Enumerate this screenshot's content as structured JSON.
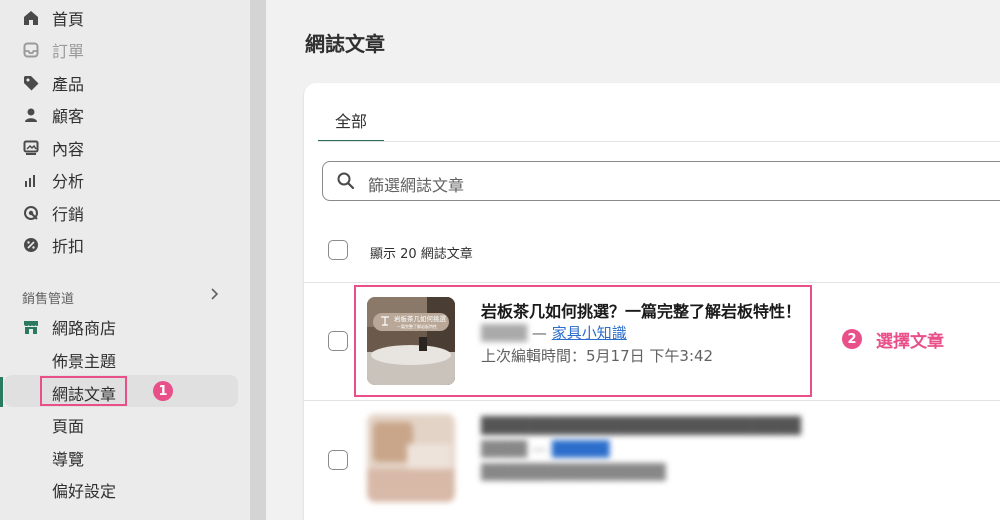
{
  "sidebar": {
    "items": [
      {
        "label": "首頁",
        "icon": "home-icon"
      },
      {
        "label": "訂單",
        "icon": "inbox-icon"
      },
      {
        "label": "產品",
        "icon": "tag-icon"
      },
      {
        "label": "顧客",
        "icon": "person-icon"
      },
      {
        "label": "內容",
        "icon": "image-icon"
      },
      {
        "label": "分析",
        "icon": "bar-chart-icon"
      },
      {
        "label": "行銷",
        "icon": "target-icon"
      },
      {
        "label": "折扣",
        "icon": "discount-icon"
      }
    ],
    "section_title": "銷售管道",
    "store_label": "網路商店",
    "sub_items": [
      "佈景主題",
      "網誌文章",
      "頁面",
      "導覽",
      "偏好設定"
    ],
    "step1_badge": "1"
  },
  "main": {
    "page_title": "網誌文章",
    "tab_all": "全部",
    "search_placeholder": "篩選網誌文章",
    "count_text": "顯示 20 網誌文章",
    "article1": {
      "title": "岩板茶几如何挑選？一篇完整了解岩板特性！",
      "dash": " — ",
      "blog": "家具小知識",
      "time": "上次編輯時間：5月17日 下午3:42",
      "thumb_text_1": "岩板茶几如何挑選",
      "thumb_text_2": "一篇完整了解岩板特性"
    },
    "step2_badge": "2",
    "step2_label": "選擇文章"
  },
  "colors": {
    "accent_pink": "#e9508a",
    "link_blue": "#2c6ecb",
    "active_green": "#2b7a5f"
  }
}
